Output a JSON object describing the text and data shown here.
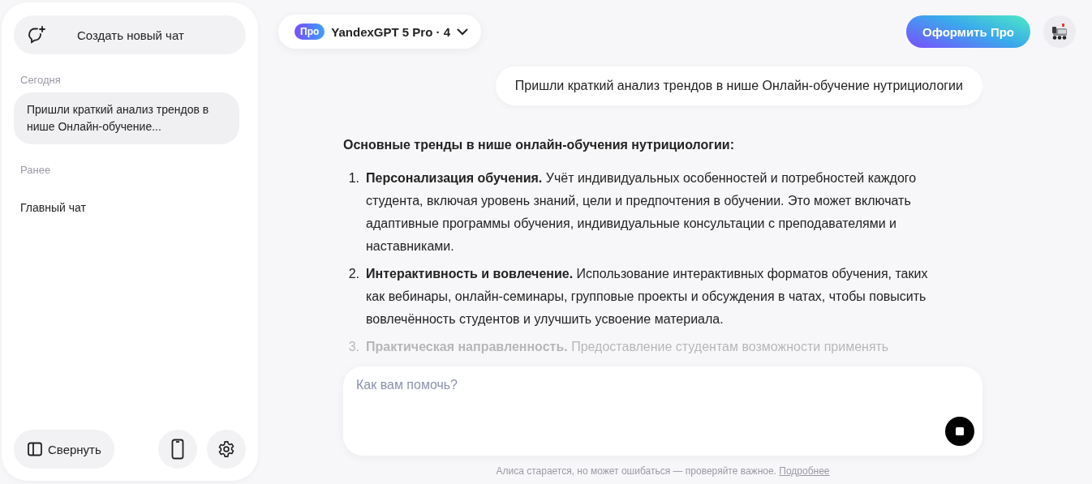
{
  "sidebar": {
    "new_chat_button": "Создать новый чат",
    "groups": [
      {
        "title": "Сегодня",
        "items": [
          {
            "label": "Пришли краткий анализ трендов в нише Онлайн-обучение...",
            "selected": true
          }
        ]
      },
      {
        "title": "Ранее",
        "items": [
          {
            "label": "Главный чат",
            "selected": false
          }
        ]
      }
    ],
    "collapse_button": "Свернуть"
  },
  "header": {
    "badge": "Про",
    "model": "YandexGPT 5 Pro · 4",
    "subscribe_button": "Оформить Про"
  },
  "user_message": "Пришли краткий анализ трендов в нише Онлайн-обучение нутрициологии",
  "answer": {
    "heading": "Основные тренды в нише онлайн-обучения нутрициологии:",
    "items": [
      {
        "number": "1.",
        "text": "**Персонализация обучения.** Учёт индивидуальных особенностей и потребностей каждого студента, включая уровень знаний, цели и предпочтения в обучении. Это может включать адаптивные программы обучения, индивидуальные консультации с преподавателями и наставниками.",
        "faded": false
      },
      {
        "number": "2.",
        "text": "**Интерактивность и вовлечение.** Использование интерактивных форматов обучения, таких как вебинары, онлайн-семинары, групповые проекты и обсуждения в чатах, чтобы повысить вовлечённость студентов и улучшить усвоение материала.",
        "faded": false
      },
      {
        "number": "3.",
        "text": "**Практическая направленность.** Предоставление студентам возможности применять",
        "faded": true
      }
    ]
  },
  "composer": {
    "placeholder": "Как вам помочь?"
  },
  "footer": {
    "disclaimer": "Алиса старается, но может ошибаться — проверяйте важное.",
    "link": "Подробнее"
  }
}
